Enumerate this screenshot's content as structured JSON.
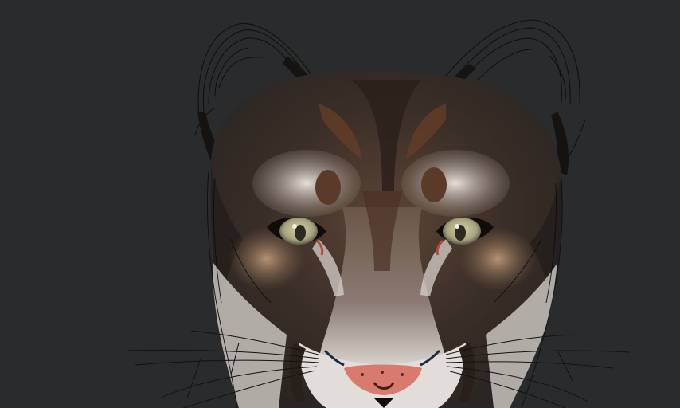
{
  "image": {
    "subject": "cougar-face-digital-painting",
    "colors": {
      "background": "#2a2b2c",
      "fur_dark": "#2b2622",
      "fur_brown": "#5a4235",
      "fur_rust": "#8a4f2c",
      "fur_tan": "#a47e5f",
      "fur_light": "#d8d2cc",
      "eye_iris": "#b4b08a",
      "nose": "#d97a6e",
      "sketch_line": "#0d0d0d"
    }
  }
}
